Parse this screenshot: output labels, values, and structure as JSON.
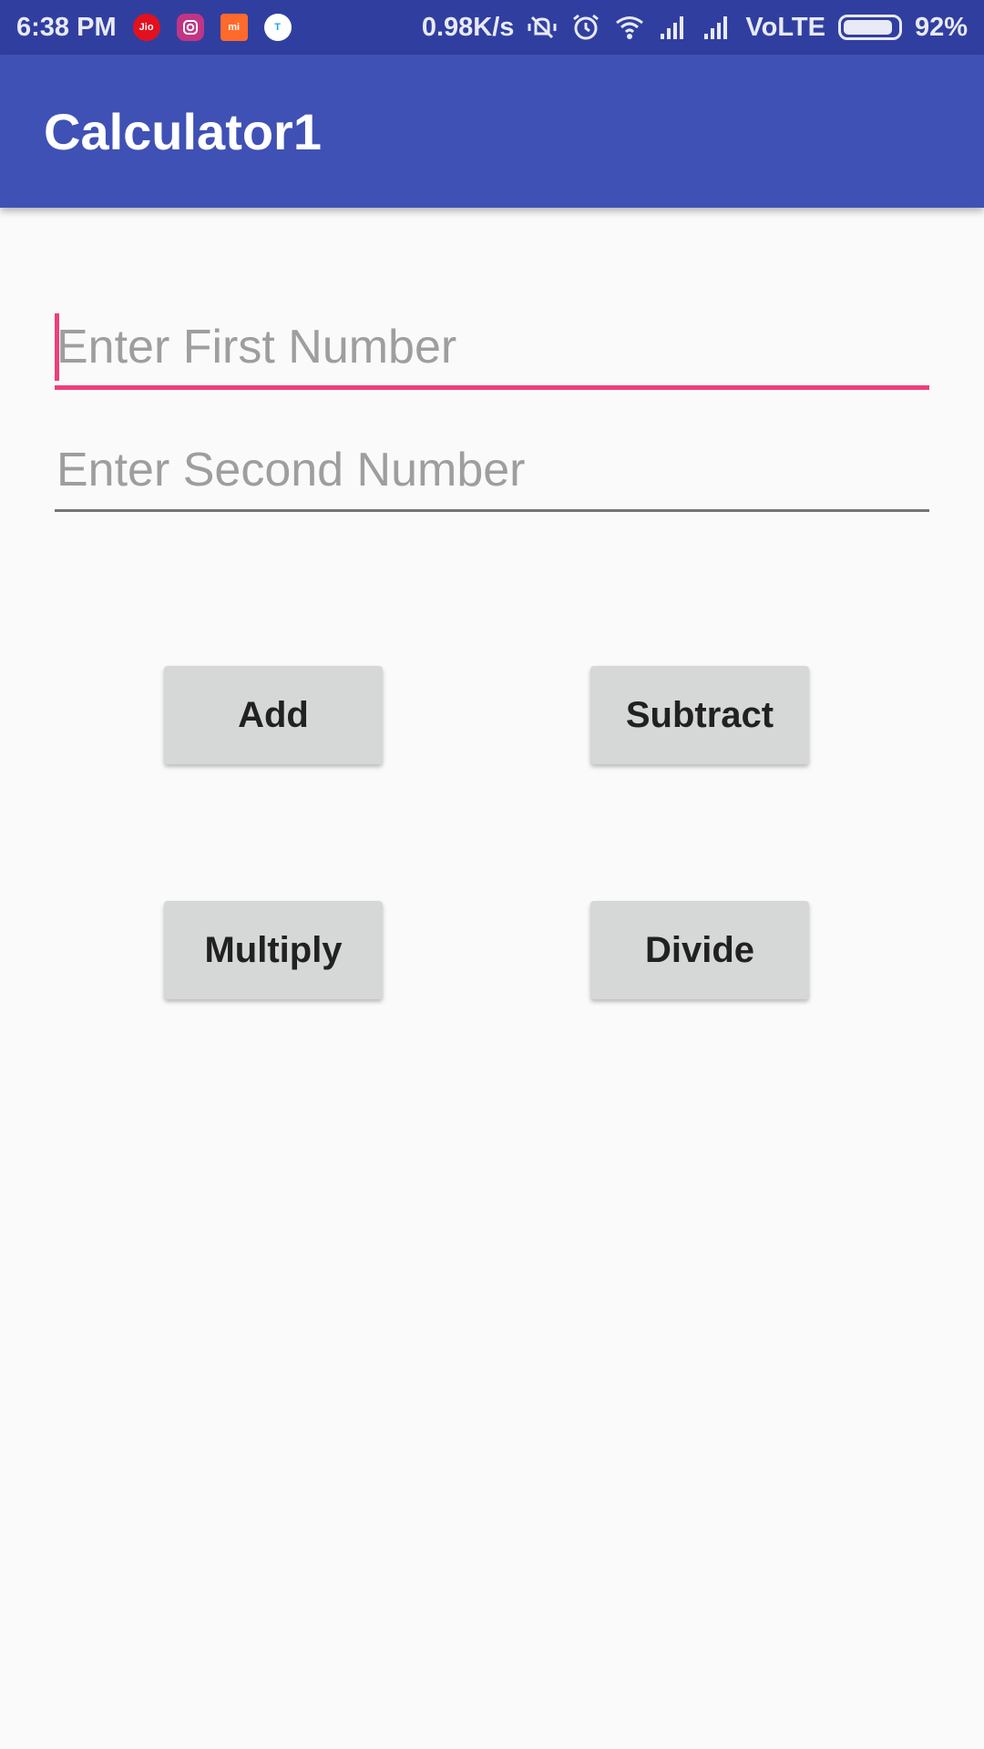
{
  "status_bar": {
    "time": "6:38 PM",
    "app_icons": [
      {
        "name": "jio-icon",
        "text": "Jio"
      },
      {
        "name": "instagram-icon",
        "text": ""
      },
      {
        "name": "mi-icon",
        "text": "mi"
      },
      {
        "name": "t-icon",
        "text": "T"
      }
    ],
    "net_speed": "0.98K/s",
    "network": "VoLTE",
    "battery_percent": "92%",
    "battery_level": 0.92
  },
  "app_bar": {
    "title": "Calculator1",
    "color": "#3f51b5"
  },
  "form": {
    "first_number": {
      "placeholder": "Enter First Number",
      "value": ""
    },
    "second_number": {
      "placeholder": "Enter Second Number",
      "value": ""
    },
    "focus_color": "#ec407a"
  },
  "buttons": {
    "add": "Add",
    "subtract": "Subtract",
    "multiply": "Multiply",
    "divide": "Divide"
  }
}
